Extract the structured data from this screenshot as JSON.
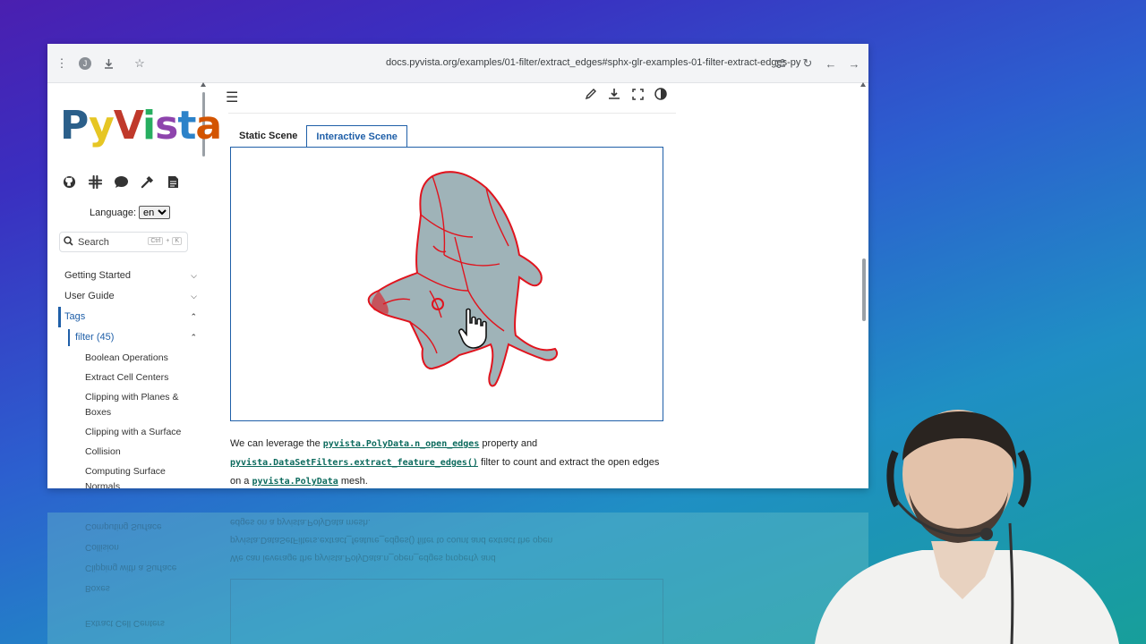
{
  "browser": {
    "avatar_letter": "J",
    "url": "docs.pyvista.org/examples/01-filter/extract_edges#sphx-glr-examples-01-filter-extract-edges-py"
  },
  "sidebar": {
    "logo": {
      "p": "P",
      "y": "y",
      "v": "V",
      "i": "i",
      "s": "s",
      "t": "t",
      "a": "a"
    },
    "language_label": "Language:",
    "language_value": "en",
    "search_placeholder": "Search",
    "search_kbd_1": "Ctrl",
    "search_kbd_plus": "+",
    "search_kbd_2": "K",
    "nav": [
      {
        "label": "Getting Started"
      },
      {
        "label": "User Guide"
      },
      {
        "label": "Tags"
      },
      {
        "label": "filter (45)"
      }
    ],
    "leaves": [
      "Boolean Operations",
      "Extract Cell Centers",
      "Clipping with Planes & Boxes",
      "Clipping with a Surface",
      "Collision",
      "Computing Surface Normals"
    ]
  },
  "main": {
    "tabs": [
      {
        "label": "Static Scene"
      },
      {
        "label": "Interactive Scene"
      }
    ],
    "para": {
      "t1": "We can leverage the ",
      "c1": "pyvista.PolyData.n_open_edges",
      "t2": " property and ",
      "c2": "pyvista.DataSetFilters.extract_feature_edges()",
      "t3": " filter to count and extract the open edges on a ",
      "c3": "pyvista.PolyData",
      "t4": " mesh."
    }
  },
  "reflection": {
    "l1": "edges on a pyvista.PolyData mesh.",
    "l2": "pyvista.DataSetFilters.extract_feature_edges() filter to count and extract the open",
    "l3": "We can leverage the pyvista.PolyData.n_open_edges property and",
    "l4": "Computing Surface",
    "l5": "Collision",
    "l6": "Clipping with a Surface",
    "l7": "Boxes",
    "l8": "Extract Cell Centers"
  },
  "colors": {
    "accent": "#1f5fa8",
    "code": "#0d6b5e",
    "mesh": "#9fb3b8",
    "edges": "#e0141e"
  }
}
